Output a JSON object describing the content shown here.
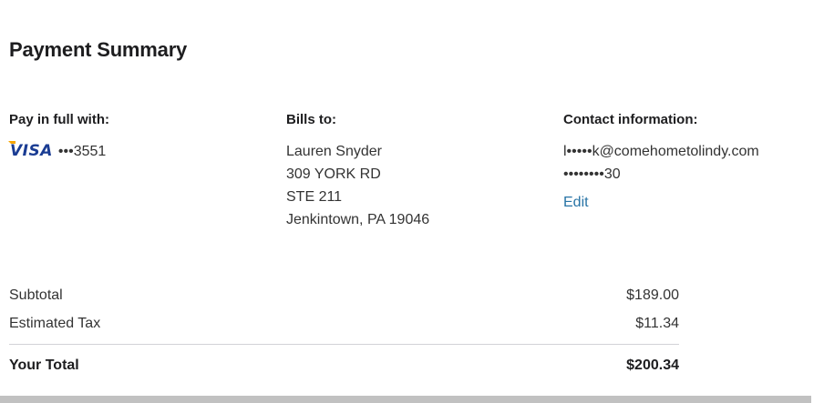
{
  "page": {
    "title": "Payment Summary"
  },
  "payment": {
    "heading": "Pay in full with:",
    "card_brand": "VISA",
    "card_number": "•••3551"
  },
  "billing": {
    "heading": "Bills to:",
    "lines": [
      "Lauren Snyder",
      "309 YORK RD",
      "STE 211",
      "Jenkintown, PA 19046"
    ]
  },
  "contact": {
    "heading": "Contact information:",
    "email": "l•••••k@comehometolindy.com",
    "phone": "••••••••30",
    "edit_label": "Edit"
  },
  "summary": {
    "subtotal_label": "Subtotal",
    "subtotal_value": "$189.00",
    "tax_label": "Estimated Tax",
    "tax_value": "$11.34",
    "total_label": "Your Total",
    "total_value": "$200.34"
  },
  "colors": {
    "link": "#2874a6",
    "visa_blue": "#1a3c93",
    "visa_gold": "#f7a600",
    "divider": "#d2d2d7",
    "scrollbar": "#c1c1c1"
  },
  "icons": {
    "card_logo": "visa-logo-icon"
  }
}
